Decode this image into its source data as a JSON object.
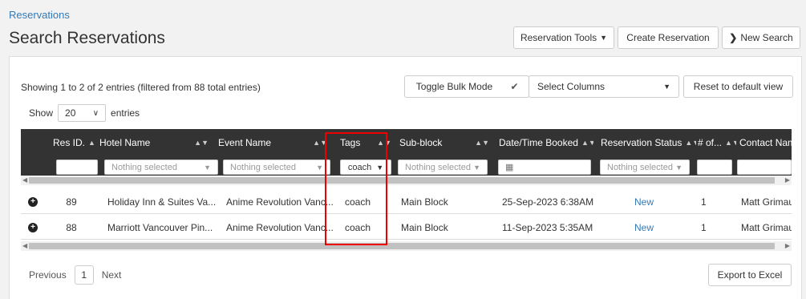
{
  "breadcrumb": "Reservations",
  "page_title": "Search Reservations",
  "top_buttons": {
    "reservation_tools": "Reservation Tools",
    "create_reservation": "Create Reservation",
    "new_search": "New Search"
  },
  "table_info": "Showing 1 to 2 of 2 entries (filtered from 88 total entries)",
  "length_menu": {
    "prefix": "Show",
    "value": "20",
    "suffix": "entries"
  },
  "toolbar": {
    "toggle_bulk": "Toggle Bulk Mode",
    "check": "✔",
    "select_columns": "Select Columns",
    "reset_view": "Reset to default view"
  },
  "columns": [
    {
      "label": ""
    },
    {
      "label": "Res ID."
    },
    {
      "label": "Hotel Name"
    },
    {
      "label": "Event Name"
    },
    {
      "label": "Tags"
    },
    {
      "label": "Sub-block"
    },
    {
      "label": "Date/Time Booked"
    },
    {
      "label": "Reservation Status"
    },
    {
      "label": "# of..."
    },
    {
      "label": "Contact Name"
    }
  ],
  "filters": {
    "hotel": "Nothing selected",
    "event": "Nothing selected",
    "tags": "coach",
    "subblock": "Nothing selected",
    "status": "Nothing selected"
  },
  "rows": [
    {
      "res_id": "89",
      "hotel": "Holiday Inn & Suites Va...",
      "event": "Anime Revolution Vanc...",
      "tags": "coach",
      "subblock": "Main Block",
      "booked": "25-Sep-2023 6:38AM",
      "status": "New",
      "count": "1",
      "contact": "Matt Grimaud"
    },
    {
      "res_id": "88",
      "hotel": "Marriott Vancouver Pin...",
      "event": "Anime Revolution Vanc...",
      "tags": "coach",
      "subblock": "Main Block",
      "booked": "11-Sep-2023 5:35AM",
      "status": "New",
      "count": "1",
      "contact": "Matt Grimaud"
    }
  ],
  "pagination": {
    "previous": "Previous",
    "page": "1",
    "next": "Next"
  },
  "export": "Export to Excel",
  "colors": {
    "link": "#337ab7",
    "header_bg": "#333333",
    "highlight": "#e00000"
  }
}
